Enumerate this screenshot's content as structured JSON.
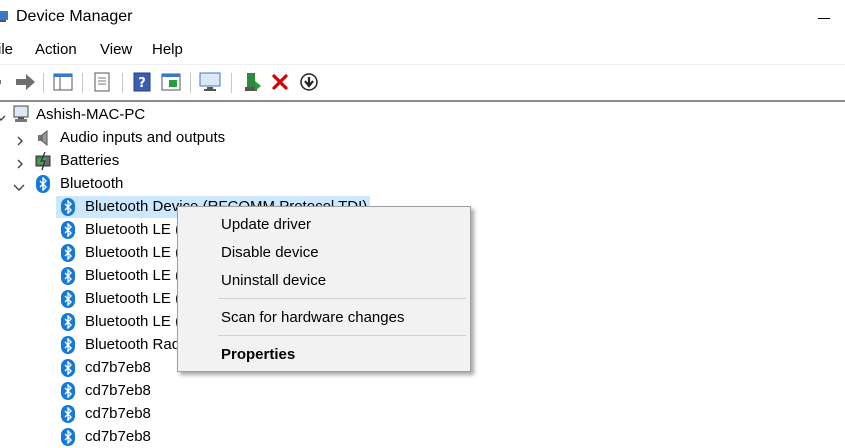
{
  "window": {
    "title": "Device Manager"
  },
  "menubar": {
    "items": [
      "ile",
      "Action",
      "View",
      "Help"
    ]
  },
  "tree": {
    "root": "Ashish-MAC-PC",
    "categories": {
      "audio": "Audio inputs and outputs",
      "batteries": "Batteries",
      "bluetooth": "Bluetooth"
    },
    "bluetooth_children": [
      "Bluetooth Device (RFCOMM Protocol TDI)",
      "Bluetooth LE (",
      "Bluetooth LE (",
      "Bluetooth LE (",
      "Bluetooth LE (",
      "Bluetooth LE (",
      "Bluetooth Rad",
      "cd7b7eb8",
      "cd7b7eb8",
      "cd7b7eb8",
      "cd7b7eb8"
    ]
  },
  "context_menu": {
    "update_driver": "Update driver",
    "disable_device": "Disable device",
    "uninstall_device": "Uninstall device",
    "scan_hardware": "Scan for hardware changes",
    "properties": "Properties"
  },
  "colors": {
    "bluetooth": "#1479d8",
    "selection": "#cce8ff",
    "uninstall_x": "#d20000"
  }
}
